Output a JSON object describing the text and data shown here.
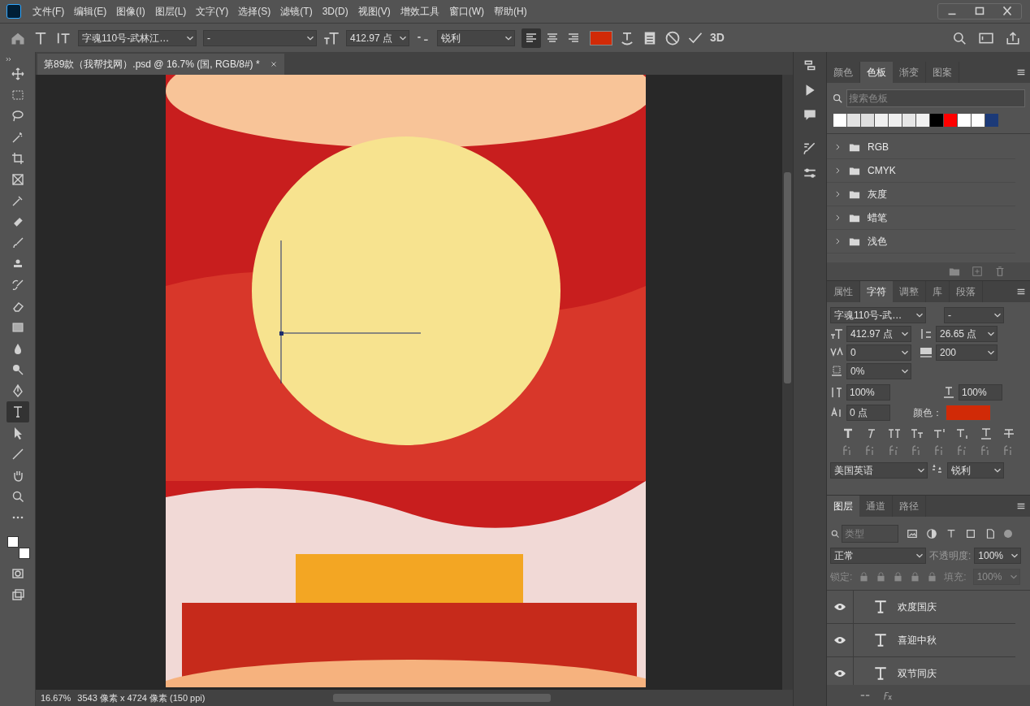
{
  "menu_bar": {
    "items": [
      "文件(F)",
      "编辑(E)",
      "图像(I)",
      "图层(L)",
      "文字(Y)",
      "选择(S)",
      "滤镜(T)",
      "3D(D)",
      "视图(V)",
      "增效工具",
      "窗口(W)",
      "帮助(H)"
    ]
  },
  "options_bar": {
    "font_family": "字魂110号-武林江…",
    "font_style": "-",
    "font_size": "412.97 点",
    "antialias": "锐利",
    "align": [
      {
        "kind": "left",
        "selected": true
      },
      {
        "kind": "center",
        "selected": false
      },
      {
        "kind": "right",
        "selected": false
      }
    ],
    "label_3d": "3D"
  },
  "document_tab": {
    "title": "第89款（我帮找网）.psd @ 16.7% (国, RGB/8#) *"
  },
  "status_bar": {
    "zoom": "16.67%",
    "info": "3543 像素 x 4724 像素 (150 ppi)"
  },
  "swatches_panel": {
    "tabs": [
      {
        "label": "颜色",
        "selected": false
      },
      {
        "label": "色板",
        "selected": true
      },
      {
        "label": "渐变",
        "selected": false
      },
      {
        "label": "图案",
        "selected": false
      }
    ],
    "search": {
      "placeholder": "搜索色板"
    },
    "swatches": [
      {
        "color": "#ffffff"
      },
      {
        "color": "#e2e2e2"
      },
      {
        "color": "#dedede"
      },
      {
        "color": "#f0f0f0"
      },
      {
        "color": "#efefef"
      },
      {
        "color": "#e6e6e6"
      },
      {
        "color": "#f2f2f2"
      },
      {
        "color": "#000000"
      },
      {
        "color": "#ff0000"
      },
      {
        "color": "#ffffff"
      },
      {
        "color": "#fefefe"
      },
      {
        "color": "#1c3a78"
      }
    ],
    "groups": [
      "RGB",
      "CMYK",
      "灰度",
      "蜡笔",
      "浅色"
    ]
  },
  "character_panel": {
    "tabs": [
      {
        "label": "属性",
        "selected": false
      },
      {
        "label": "字符",
        "selected": true
      },
      {
        "label": "调整",
        "selected": false
      },
      {
        "label": "库",
        "selected": false
      },
      {
        "label": "段落",
        "selected": false
      }
    ],
    "font_family": "字魂110号-武…",
    "font_style": "-",
    "font_size": "412.97 点",
    "leading": "26.65 点",
    "kerning": "0",
    "tracking": "200",
    "tsume": "0%",
    "vertical_scale": "100%",
    "horizontal_scale": "100%",
    "baseline_shift": "0 点",
    "color_label": "颜色：",
    "language": "美国英语",
    "antialias": "锐利"
  },
  "layers_panel": {
    "tabs": [
      {
        "label": "图层",
        "selected": true
      },
      {
        "label": "通道",
        "selected": false
      },
      {
        "label": "路径",
        "selected": false
      }
    ],
    "filter": {
      "placeholder": "类型"
    },
    "blend_mode": "正常",
    "opacity_label": "不透明度:",
    "opacity": "100%",
    "lock_label": "锁定:",
    "fill_label": "填充:",
    "fill": "100%",
    "layers": [
      {
        "name": "欢度国庆",
        "visible": true
      },
      {
        "name": "喜迎中秋",
        "visible": true
      },
      {
        "name": "双节同庆",
        "visible": true
      }
    ]
  }
}
